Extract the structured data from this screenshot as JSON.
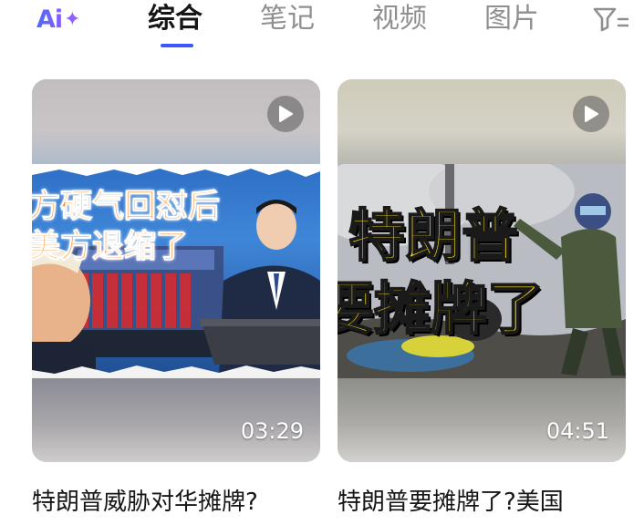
{
  "topbar": {
    "logo_text": "Ai",
    "logo_mark": "✦",
    "tabs": [
      {
        "label": "综合",
        "active": true
      },
      {
        "label": "笔记",
        "active": false
      },
      {
        "label": "视频",
        "active": false
      },
      {
        "label": "图片",
        "active": false
      }
    ],
    "filter_icon": "filter-icon",
    "accent_color": "#3a58ff"
  },
  "results": [
    {
      "thumbnail_text_line1": "方硬气回怼后",
      "thumbnail_text_line2": "美方退缩了",
      "duration": "03:29",
      "title": "特朗普威胁对华摊牌?"
    },
    {
      "thumbnail_text_line1": "特朗普",
      "thumbnail_text_line2": "要摊牌了",
      "duration": "04:51",
      "title": "特朗普要摊牌了?美国"
    }
  ],
  "icons": {
    "play": "play-icon",
    "filter": "filter-icon"
  }
}
